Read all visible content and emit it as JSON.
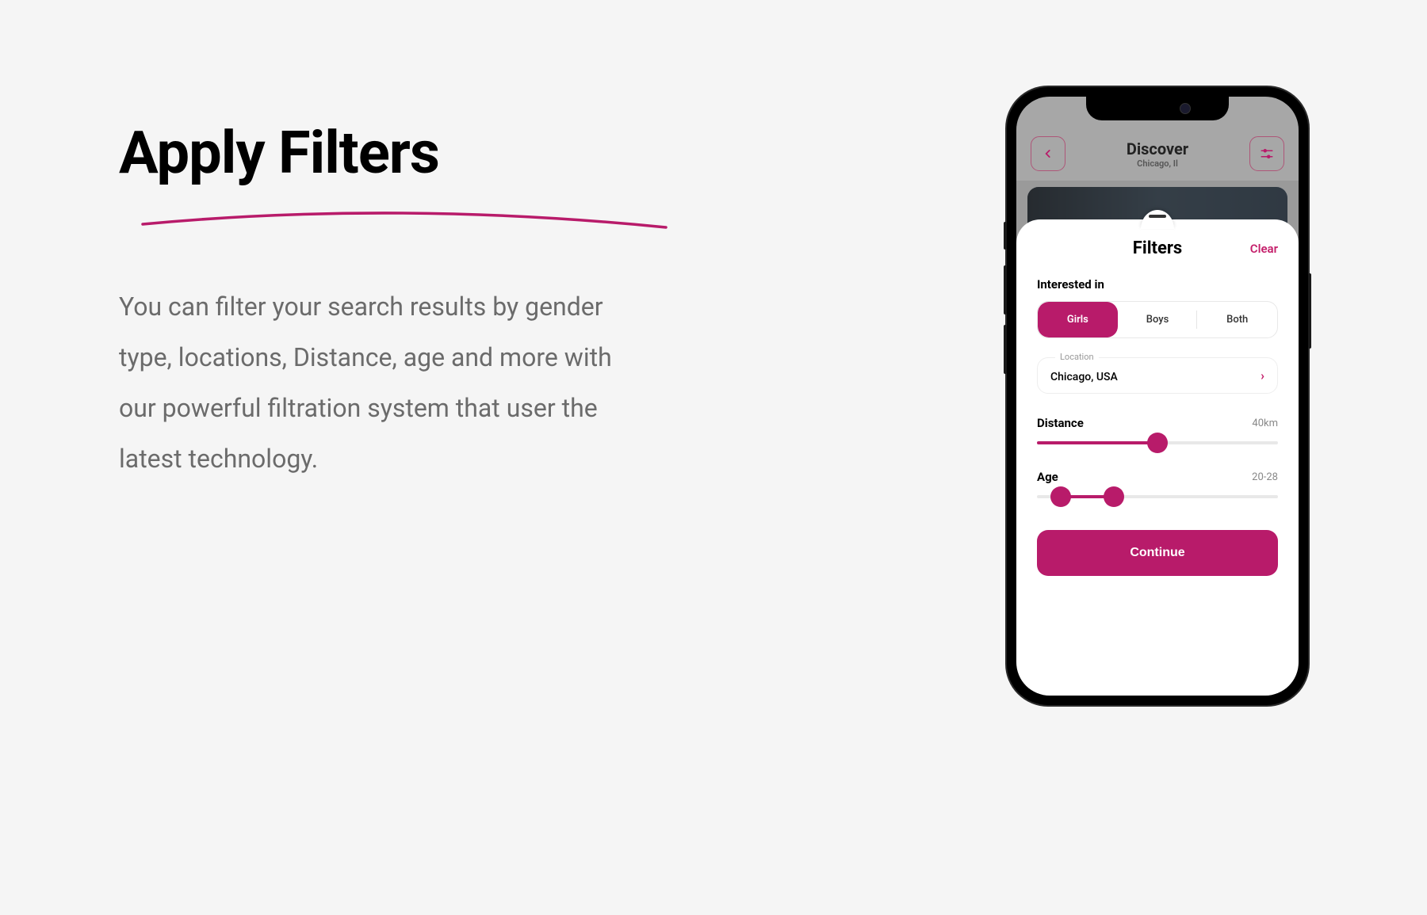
{
  "hero": {
    "title": "Apply Filters",
    "description": "You can filter your search results by gender type, locations, Distance, age and more with our powerful filtration system that user the latest technology."
  },
  "phone": {
    "header": {
      "title": "Discover",
      "subtitle": "Chicago, Il"
    },
    "sheet": {
      "title": "Filters",
      "clear_label": "Clear",
      "interested_label": "Interested in",
      "interested_options": [
        "Girls",
        "Boys",
        "Both"
      ],
      "interested_active_index": 0,
      "location_label": "Location",
      "location_value": "Chicago, USA",
      "distance_label": "Distance",
      "distance_value": "40km",
      "distance_pct": 50,
      "age_label": "Age",
      "age_value": "20-28",
      "age_low_pct": 10,
      "age_high_pct": 32,
      "continue_label": "Continue"
    }
  },
  "colors": {
    "accent": "#b81b6a"
  }
}
